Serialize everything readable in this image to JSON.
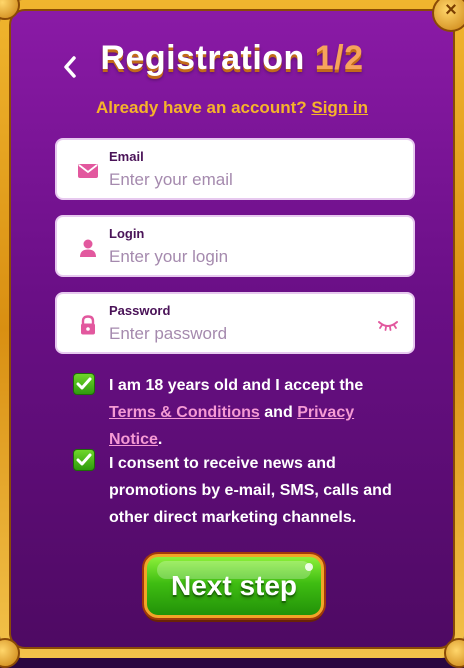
{
  "header": {
    "title": "Registration",
    "step": "1/2",
    "back_icon": "chevron-left-icon",
    "close_icon": "close-icon"
  },
  "login_prompt": {
    "text": "Already have an account?",
    "link": "Sign in"
  },
  "fields": {
    "email": {
      "label": "Email",
      "placeholder": "Enter your email",
      "value": "",
      "icon": "envelope-icon"
    },
    "login": {
      "label": "Login",
      "placeholder": "Enter your login",
      "value": "",
      "icon": "user-icon"
    },
    "password": {
      "label": "Password",
      "placeholder": "Enter password",
      "value": "",
      "icon": "lock-icon",
      "toggle_icon": "eye-closed-icon"
    }
  },
  "consents": {
    "age": {
      "checked": true,
      "text": "I am 18 years old and I accept the",
      "terms_link": "Terms & Conditions",
      "and": "and",
      "privacy_link": "Privacy Notice",
      "end": "."
    },
    "marketing": {
      "checked": true,
      "text": "I consent to receive news and promotions by e-mail, SMS, calls and other direct marketing channels."
    }
  },
  "next_button": {
    "label": "Next step"
  },
  "colors": {
    "panel": "#6a0f86",
    "frame": "#f0b52e",
    "accent_orange": "#f6b32a",
    "link_pink": "#f59ad4",
    "button_green": "#3fbd12",
    "icon_pink": "#e2589e"
  }
}
